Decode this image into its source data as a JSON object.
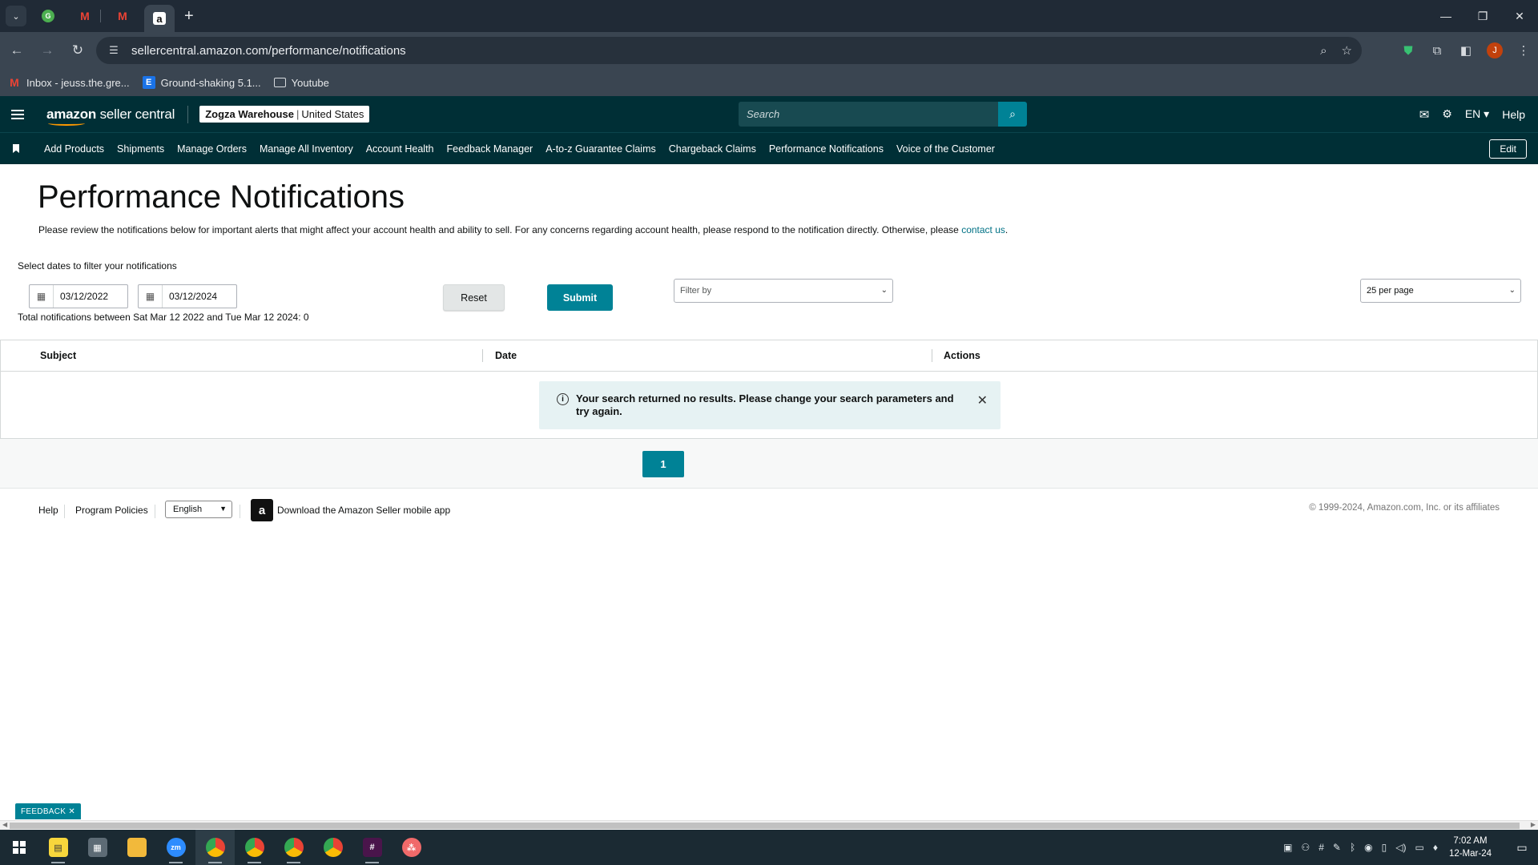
{
  "browser": {
    "tabs": [
      {
        "icon": "grammarly-icon",
        "active": false
      },
      {
        "icon": "gmail-icon",
        "active": false
      },
      {
        "icon": "gmail-icon",
        "active": false
      },
      {
        "icon": "amazon-icon",
        "active": true
      }
    ],
    "url": "sellercentral.amazon.com/performance/notifications",
    "profile_initial": "J",
    "bookmarks": [
      {
        "label": "Inbox - jeuss.the.gre...",
        "icon": "gmail-icon"
      },
      {
        "label": "Ground-shaking 5.1...",
        "icon": "e-icon"
      },
      {
        "label": "Youtube",
        "icon": "folder-icon"
      }
    ]
  },
  "header": {
    "logo_bold": "amazon",
    "logo_rest": " seller central",
    "store_name": "Zogza Warehouse",
    "marketplace": "United States",
    "search_placeholder": "Search",
    "language": "EN",
    "help": "Help"
  },
  "nav": {
    "items": [
      "Add Products",
      "Shipments",
      "Manage Orders",
      "Manage All Inventory",
      "Account Health",
      "Feedback Manager",
      "A-to-z Guarantee Claims",
      "Chargeback Claims",
      "Performance Notifications",
      "Voice of the Customer"
    ],
    "edit_label": "Edit"
  },
  "page": {
    "title": "Performance Notifications",
    "intro": "Please review the notifications below for important alerts that might affect your account health and ability to sell. For any concerns regarding account health, please respond to the notification directly. Otherwise, please ",
    "intro_link": "contact us",
    "intro_end": ".",
    "filter_label": "Select dates to filter your notifications",
    "date_from": "03/12/2022",
    "date_to": "03/12/2024",
    "totals": "Total notifications between Sat Mar 12 2022 and Tue Mar 12 2024: 0",
    "reset_label": "Reset",
    "submit_label": "Submit",
    "filter_placeholder": "Filter by",
    "per_page": "25 per page"
  },
  "table": {
    "columns": [
      "Subject",
      "Date",
      "Actions"
    ],
    "empty_message": "Your search returned no results. Please change your search parameters and try again."
  },
  "pagination": {
    "current_page": "1"
  },
  "footer": {
    "help": "Help",
    "policies": "Program Policies",
    "language": "English",
    "app_text": "Download the Amazon Seller mobile app",
    "copyright": "© 1999-2024, Amazon.com, Inc. or its affiliates"
  },
  "feedback_tab": "FEEDBACK",
  "taskbar": {
    "time": "7:02 AM",
    "date": "12-Mar-24",
    "zoom_label": "zm"
  },
  "colors": {
    "amazon_header": "#002f36",
    "teal_accent": "#008296",
    "link": "#007185"
  }
}
